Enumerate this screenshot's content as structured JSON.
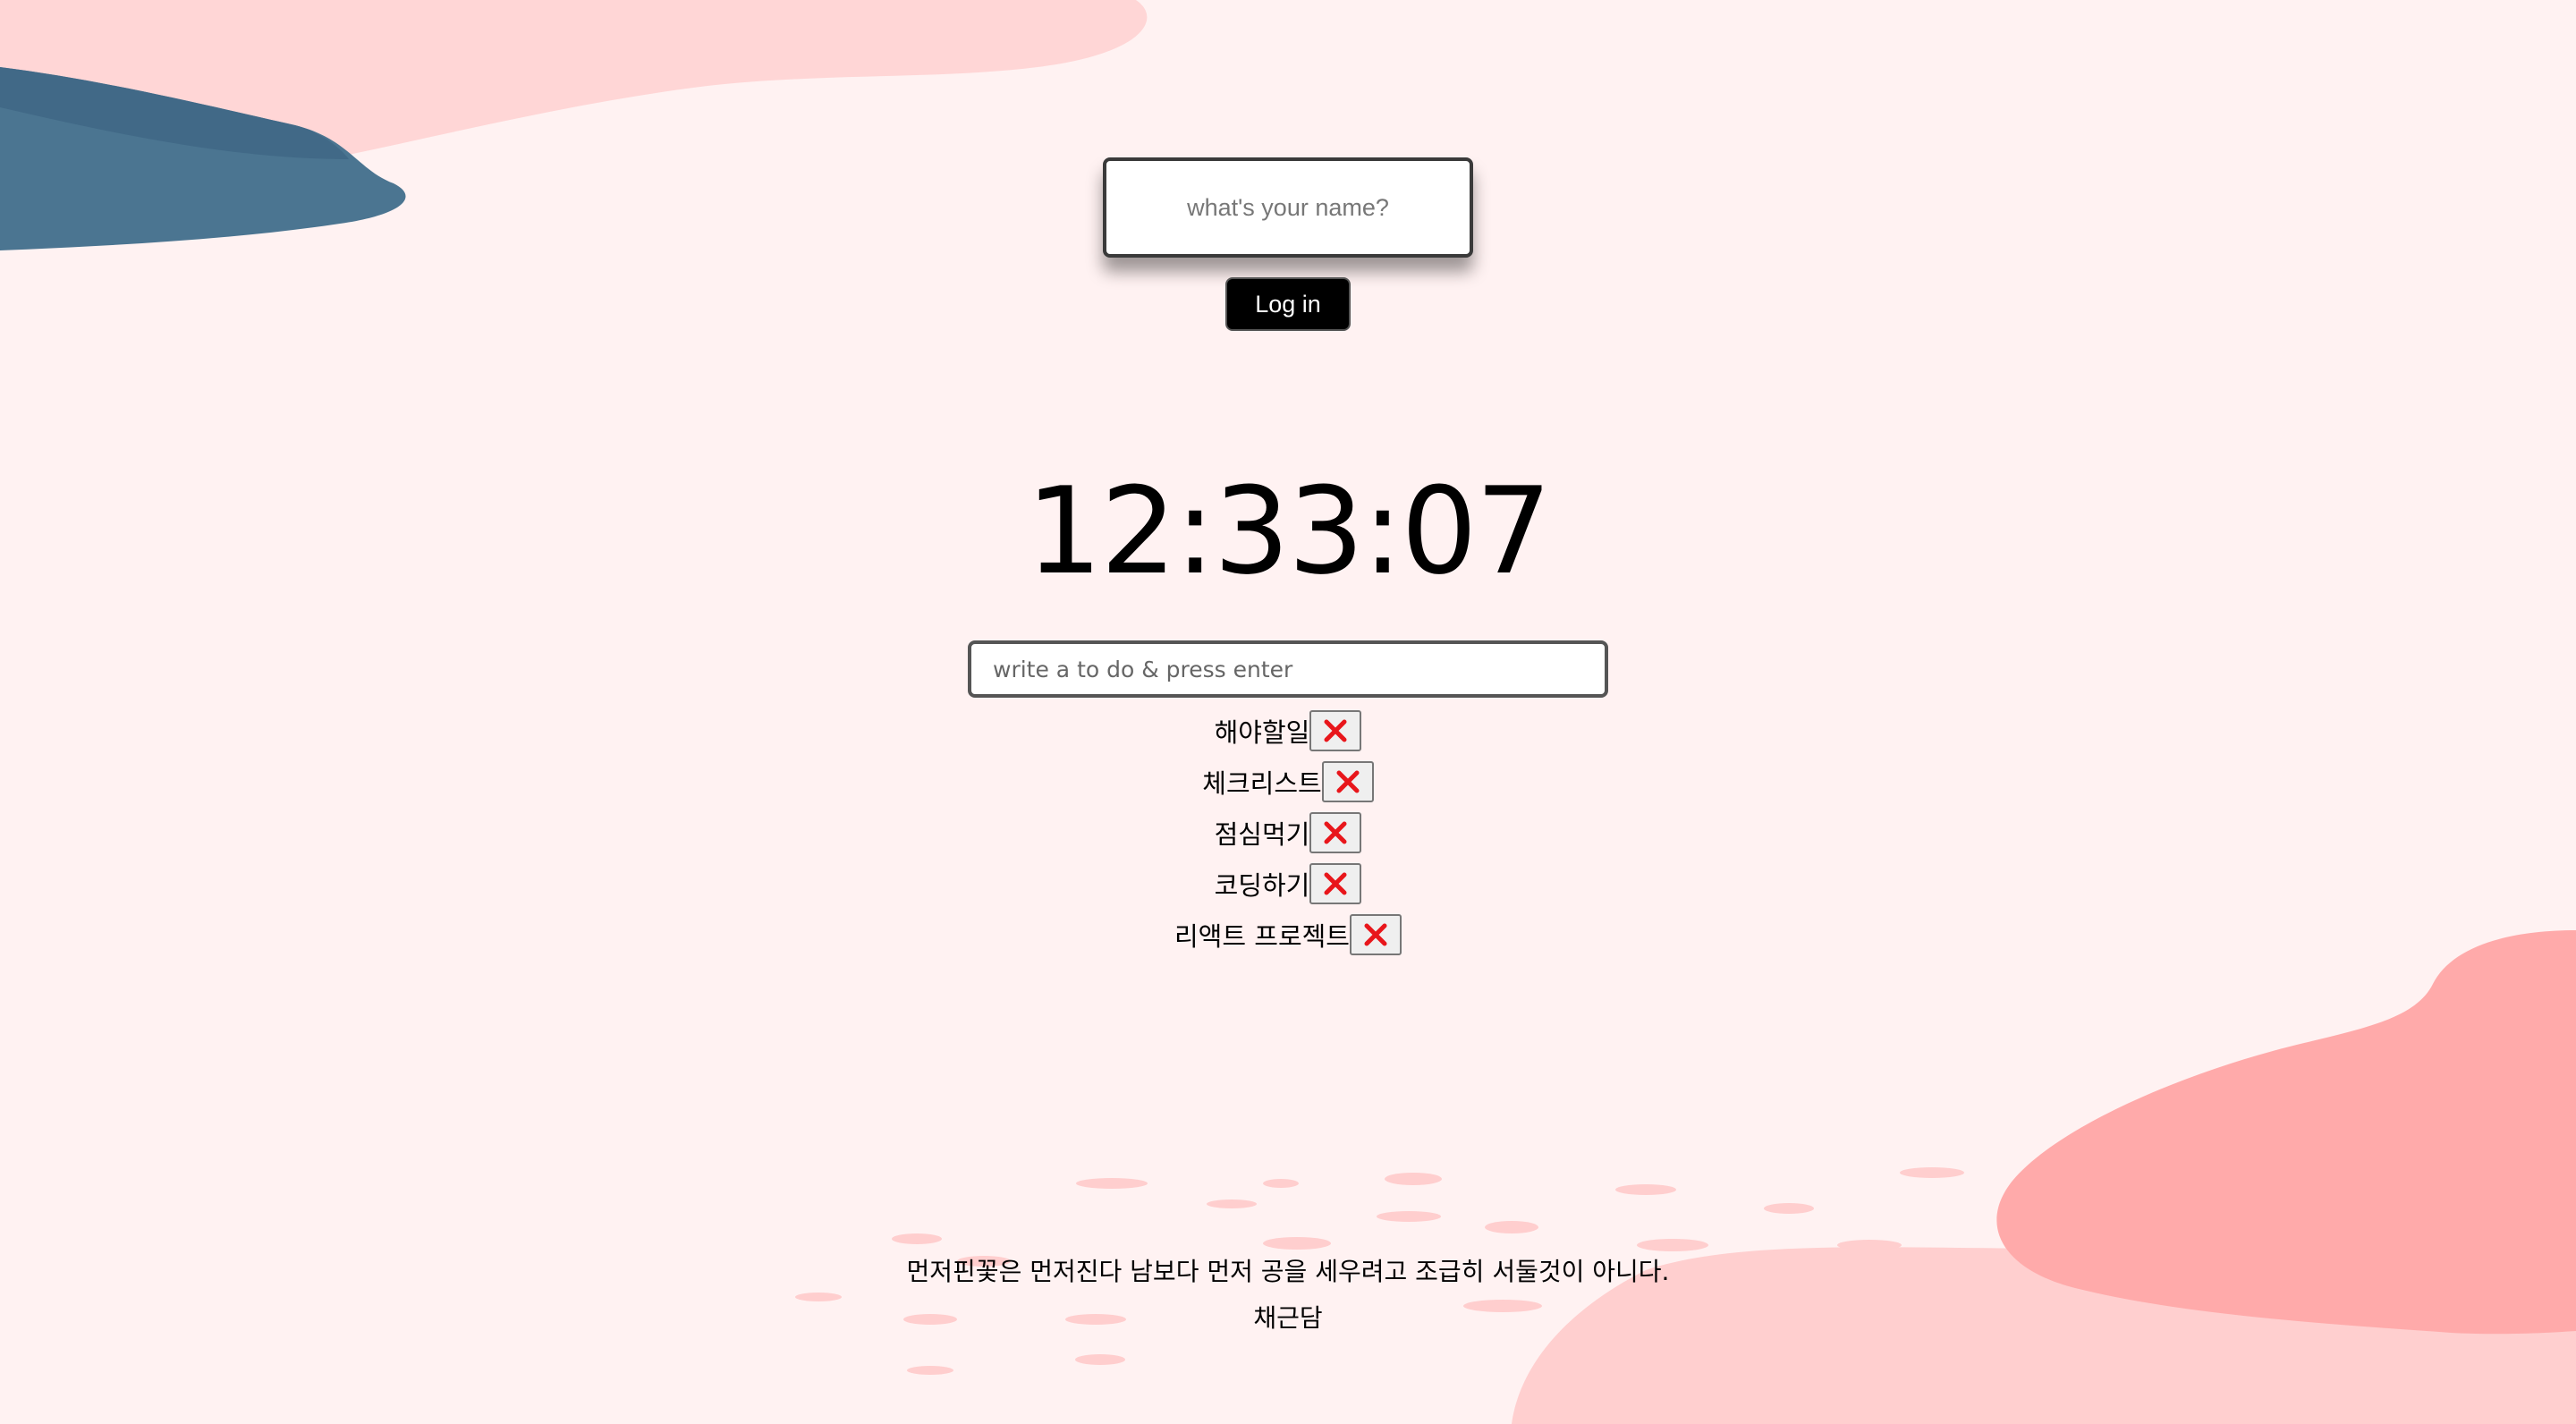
{
  "login": {
    "name_placeholder": "what's your name?",
    "button_label": "Log in"
  },
  "clock": {
    "time": "12:33:07"
  },
  "todo": {
    "placeholder": "write a to do & press enter",
    "delete_icon": "red-x-icon",
    "items": [
      {
        "text": "해야할일"
      },
      {
        "text": "체크리스트"
      },
      {
        "text": "점심먹기"
      },
      {
        "text": "코딩하기"
      },
      {
        "text": "리액트 프로젝트"
      }
    ]
  },
  "quote": {
    "text": "먼저핀꽃은 먼저진다 남보다 먼저 공을 세우려고 조급히 서둘것이 아니다.",
    "author": "채근담"
  },
  "colors": {
    "background": "#fff2f2",
    "blob_pink_light": "#ffd6d6",
    "blob_pink": "#ffaaaa",
    "blob_blue": "#4b7591",
    "delete_red": "#e8161b"
  }
}
